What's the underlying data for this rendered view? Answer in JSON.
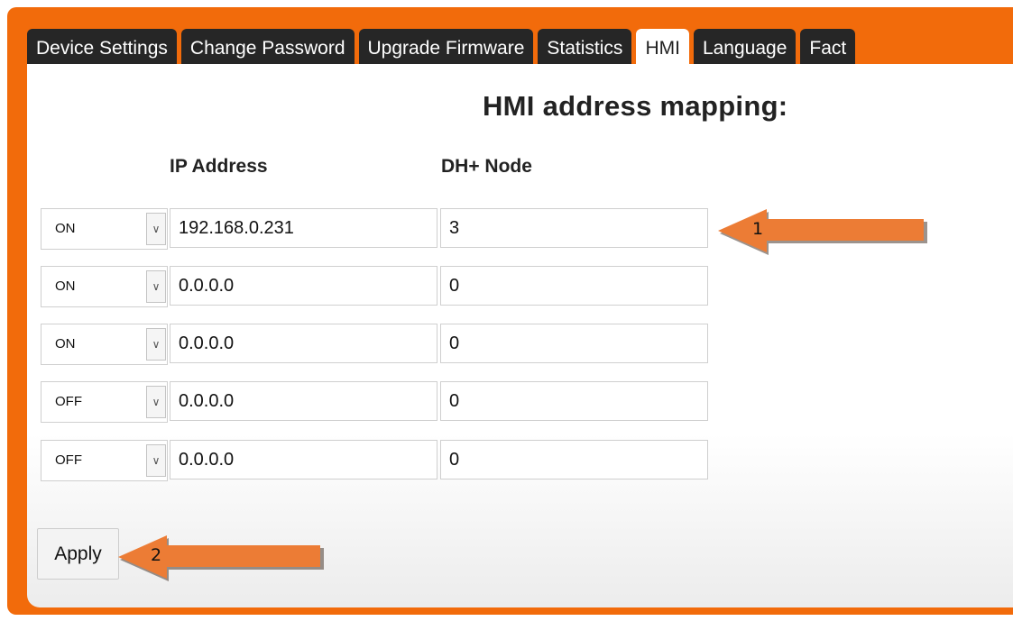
{
  "tabs": [
    {
      "label": "Device Settings",
      "active": false
    },
    {
      "label": "Change Password",
      "active": false
    },
    {
      "label": "Upgrade Firmware",
      "active": false
    },
    {
      "label": "Statistics",
      "active": false
    },
    {
      "label": "HMI",
      "active": true
    },
    {
      "label": "Language",
      "active": false
    },
    {
      "label": "Fact",
      "active": false
    }
  ],
  "heading": "HMI address mapping:",
  "columns": {
    "ip": "IP Address",
    "node": "DH+ Node"
  },
  "rows": [
    {
      "state": "ON",
      "ip": "192.168.0.231",
      "node": "3"
    },
    {
      "state": "ON",
      "ip": "0.0.0.0",
      "node": "0"
    },
    {
      "state": "ON",
      "ip": "0.0.0.0",
      "node": "0"
    },
    {
      "state": "OFF",
      "ip": "0.0.0.0",
      "node": "0"
    },
    {
      "state": "OFF",
      "ip": "0.0.0.0",
      "node": "0"
    }
  ],
  "apply_label": "Apply",
  "callouts": [
    {
      "number": "1"
    },
    {
      "number": "2"
    }
  ],
  "colors": {
    "frame": "#f26b0b",
    "tab_bg": "#262626",
    "arrow": "#ec7c35"
  },
  "icons": {
    "select_dropdown": "chevron-down-icon",
    "callout": "arrow-left-icon"
  }
}
